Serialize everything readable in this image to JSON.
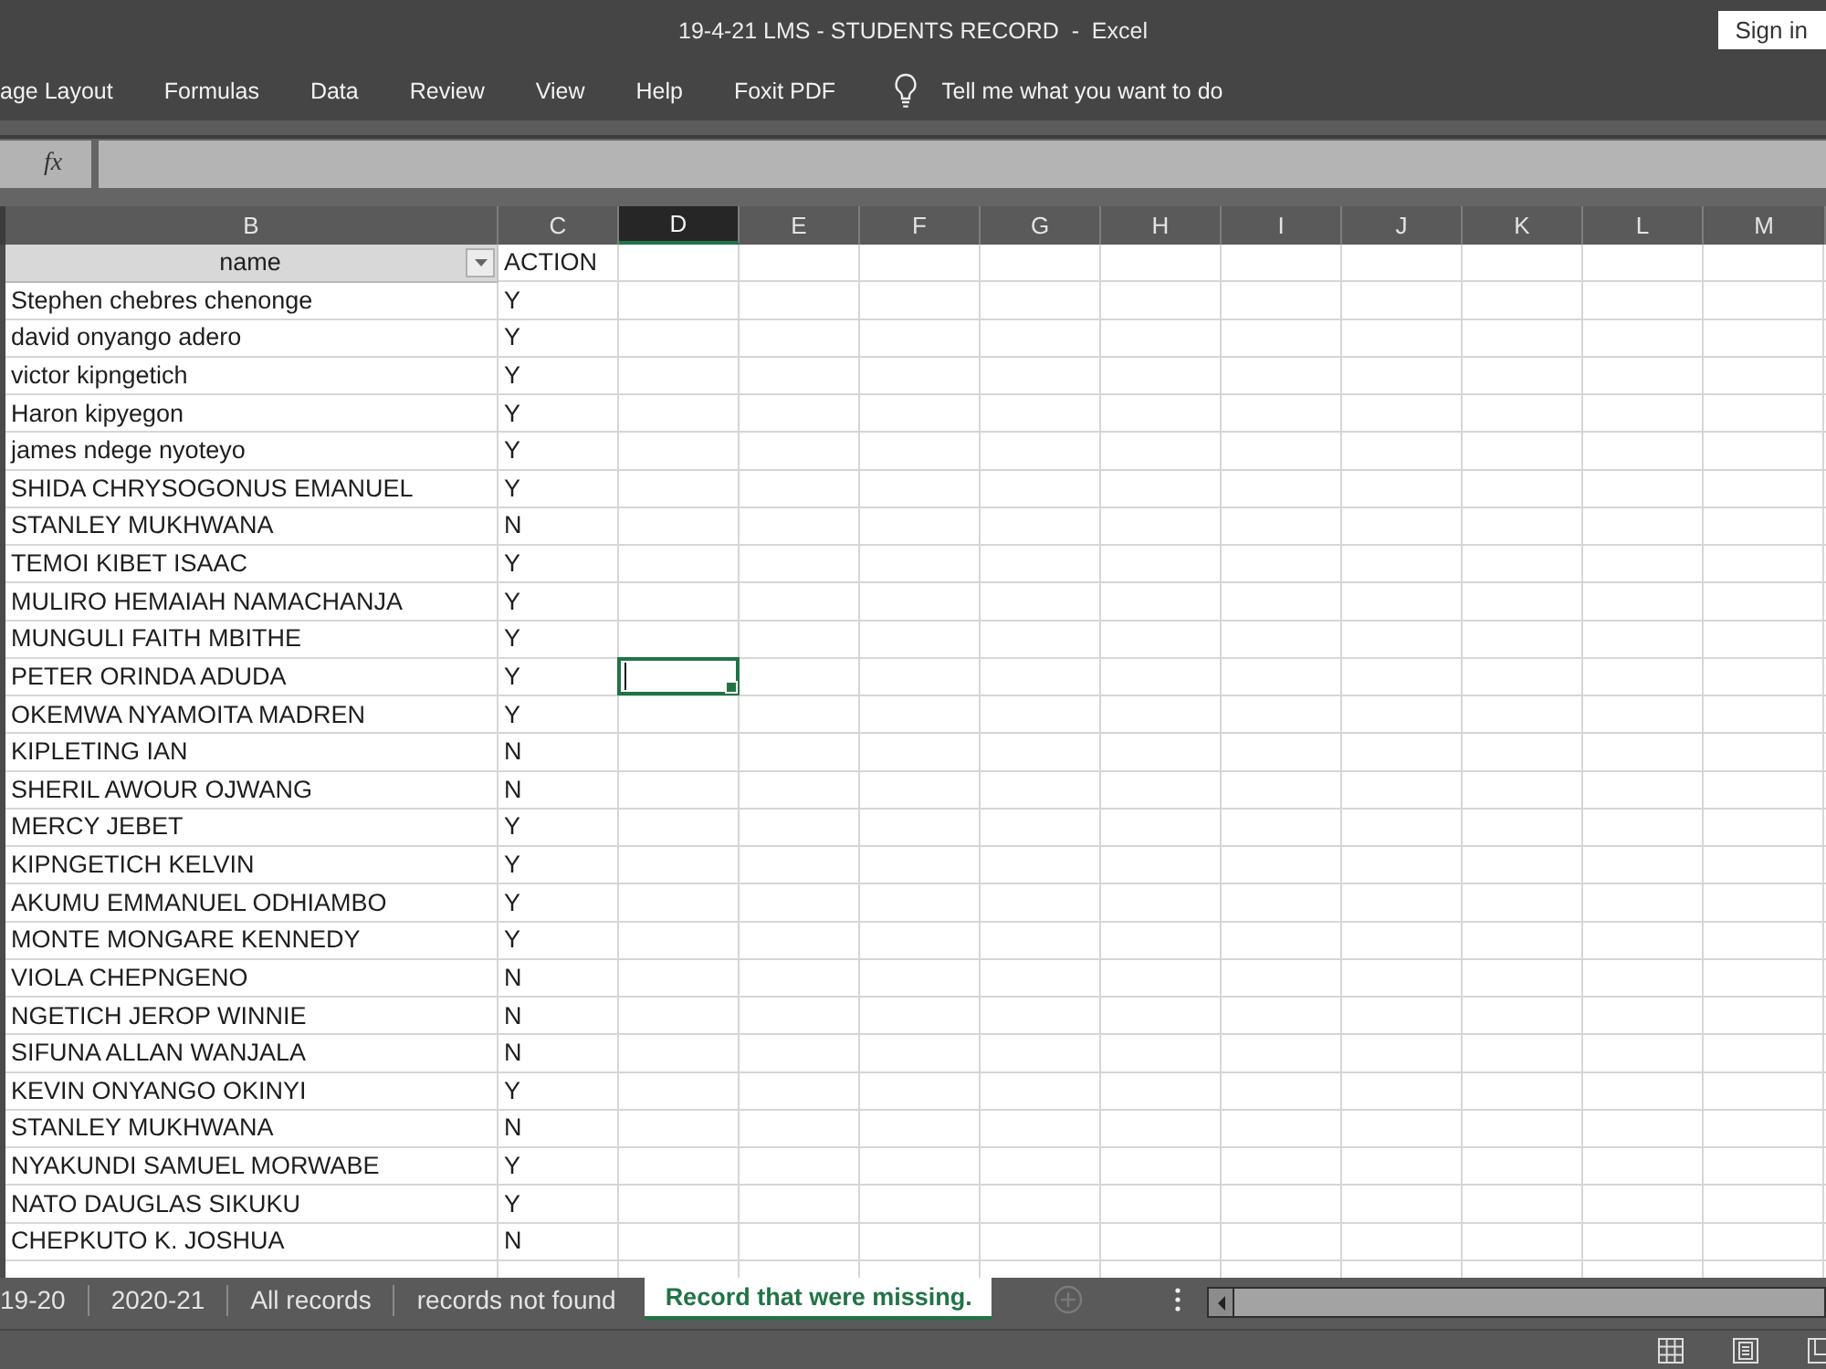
{
  "window": {
    "title": "19-4-21 LMS - STUDENTS RECORD  -  Excel",
    "sign_in": "Sign in"
  },
  "ribbon": {
    "tabs": [
      {
        "label": "age Layout"
      },
      {
        "label": "Formulas"
      },
      {
        "label": "Data"
      },
      {
        "label": "Review"
      },
      {
        "label": "View"
      },
      {
        "label": "Help"
      },
      {
        "label": "Foxit PDF"
      }
    ],
    "tell_me": {
      "placeholder": "Tell me what you want to do"
    }
  },
  "formula_bar": {
    "function_button": "fx"
  },
  "columns": [
    {
      "label": "B",
      "selected": false
    },
    {
      "label": "C",
      "selected": false
    },
    {
      "label": "D",
      "selected": true
    },
    {
      "label": "E",
      "selected": false
    },
    {
      "label": "F",
      "selected": false
    },
    {
      "label": "G",
      "selected": false
    },
    {
      "label": "H",
      "selected": false
    },
    {
      "label": "I",
      "selected": false
    },
    {
      "label": "J",
      "selected": false
    },
    {
      "label": "K",
      "selected": false
    },
    {
      "label": "L",
      "selected": false
    },
    {
      "label": "M",
      "selected": false
    }
  ],
  "table": {
    "header": {
      "name": "name",
      "action": "ACTION",
      "filter": true
    },
    "rows": [
      {
        "name": "Stephen chebres chenonge",
        "action": "Y",
        "selected": false
      },
      {
        "name": "david onyango adero",
        "action": "Y",
        "selected": false
      },
      {
        "name": "victor kipngetich",
        "action": "Y",
        "selected": false
      },
      {
        "name": "Haron kipyegon",
        "action": "Y",
        "selected": false
      },
      {
        "name": "james ndege nyoteyo",
        "action": "Y",
        "selected": false
      },
      {
        "name": "SHIDA CHRYSOGONUS EMANUEL",
        "action": "Y",
        "selected": false
      },
      {
        "name": "STANLEY MUKHWANA",
        "action": "N",
        "selected": false
      },
      {
        "name": "TEMOI KIBET ISAAC",
        "action": "Y",
        "selected": false
      },
      {
        "name": "MULIRO HEMAIAH NAMACHANJA",
        "action": "Y",
        "selected": false
      },
      {
        "name": "MUNGULI FAITH MBITHE",
        "action": "Y",
        "selected": false
      },
      {
        "name": "PETER ORINDA ADUDA",
        "action": "Y",
        "selected": true
      },
      {
        "name": "OKEMWA NYAMOITA MADREN",
        "action": "Y",
        "selected": false
      },
      {
        "name": "KIPLETING IAN",
        "action": "N",
        "selected": false
      },
      {
        "name": "SHERIL AWOUR OJWANG",
        "action": "N",
        "selected": false
      },
      {
        "name": "MERCY JEBET",
        "action": "Y",
        "selected": false
      },
      {
        "name": "KIPNGETICH KELVIN",
        "action": "Y",
        "selected": false
      },
      {
        "name": "AKUMU EMMANUEL ODHIAMBO",
        "action": "Y",
        "selected": false
      },
      {
        "name": "MONTE MONGARE KENNEDY",
        "action": "Y",
        "selected": false
      },
      {
        "name": "VIOLA CHEPNGENO",
        "action": "N",
        "selected": false
      },
      {
        "name": "NGETICH JEROP WINNIE",
        "action": "N",
        "selected": false
      },
      {
        "name": "SIFUNA ALLAN WANJALA",
        "action": "N",
        "selected": false
      },
      {
        "name": "KEVIN ONYANGO OKINYI",
        "action": "Y",
        "selected": false
      },
      {
        "name": "STANLEY MUKHWANA",
        "action": "N",
        "selected": false
      },
      {
        "name": "NYAKUNDI SAMUEL MORWABE",
        "action": "Y",
        "selected": false
      },
      {
        "name": "NATO DAUGLAS SIKUKU",
        "action": "Y",
        "selected": false
      },
      {
        "name": "CHEPKUTO K. JOSHUA",
        "action": "N",
        "selected": false
      }
    ]
  },
  "sheet_tabs": [
    {
      "label": "19-20",
      "selected": false
    },
    {
      "label": "2020-21",
      "selected": false
    },
    {
      "label": "All records",
      "selected": false
    },
    {
      "label": "records not found",
      "selected": false
    },
    {
      "label": "Record that were missing.",
      "selected": true
    }
  ]
}
